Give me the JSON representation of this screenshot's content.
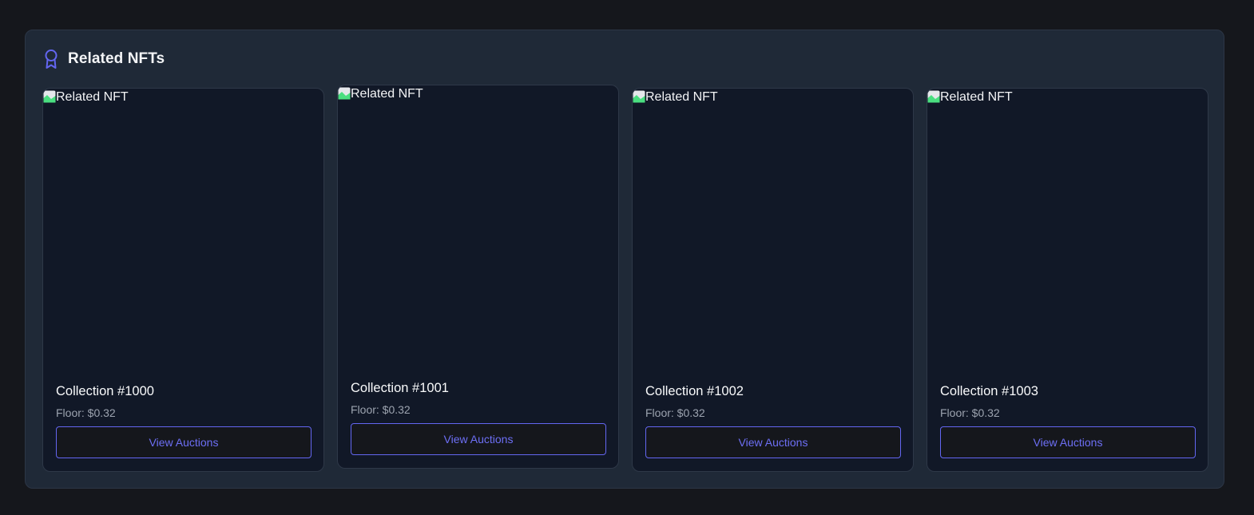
{
  "section": {
    "title": "Related NFTs",
    "icon": "award-ribbon-icon",
    "accent_color": "#6366f1"
  },
  "cards": [
    {
      "image_alt": "Related NFT",
      "name": "Collection #1000",
      "floor": "Floor: $0.32",
      "button_label": "View Auctions"
    },
    {
      "image_alt": "Related NFT",
      "name": "Collection #1001",
      "floor": "Floor: $0.32",
      "button_label": "View Auctions"
    },
    {
      "image_alt": "Related NFT",
      "name": "Collection #1002",
      "floor": "Floor: $0.32",
      "button_label": "View Auctions"
    },
    {
      "image_alt": "Related NFT",
      "name": "Collection #1003",
      "floor": "Floor: $0.32",
      "button_label": "View Auctions"
    }
  ]
}
